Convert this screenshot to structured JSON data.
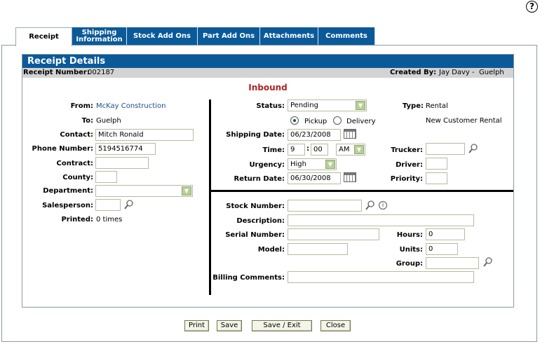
{
  "tabs": [
    {
      "label": "Receipt"
    },
    {
      "label": "Shipping Information"
    },
    {
      "label": "Stock Add Ons"
    },
    {
      "label": "Part Add Ons"
    },
    {
      "label": "Attachments"
    },
    {
      "label": "Comments"
    }
  ],
  "header": {
    "title": "Receipt Details",
    "receipt_number_label": "Receipt Number:",
    "receipt_number": "002187",
    "created_by_label": "Created By:",
    "created_by": "Jay Davy -  Guelph"
  },
  "section_title": "Inbound",
  "left": {
    "from_label": "From:",
    "from_value": "McKay Construction",
    "to_label": "To:",
    "to_value": "Guelph",
    "contact_label": "Contact:",
    "contact_value": "Mitch Ronald",
    "phone_label": "Phone Number:",
    "phone_value": "5194516774",
    "contract_label": "Contract:",
    "contract_value": "",
    "county_label": "County:",
    "county_value": "",
    "department_label": "Department:",
    "department_value": "",
    "salesperson_label": "Salesperson:",
    "salesperson_value": "",
    "printed_label": "Printed:",
    "printed_value": "0 times"
  },
  "right_top": {
    "status_label": "Status:",
    "status_value": "Pending",
    "type_label": "Type:",
    "type_value": "Rental",
    "pickup_label": "Pickup",
    "delivery_label": "Delivery",
    "new_customer_note": "New Customer Rental",
    "shipping_date_label": "Shipping Date:",
    "shipping_date_value": "06/23/2008",
    "time_label": "Time:",
    "time_hour": "9",
    "time_minute": "00",
    "time_ampm": "AM",
    "trucker_label": "Trucker:",
    "trucker_value": "",
    "urgency_label": "Urgency:",
    "urgency_value": "High",
    "driver_label": "Driver:",
    "driver_value": "",
    "return_date_label": "Return Date:",
    "return_date_value": "06/30/2008",
    "priority_label": "Priority:",
    "priority_value": ""
  },
  "right_bottom": {
    "stock_number_label": "Stock Number:",
    "stock_number_value": "",
    "description_label": "Description:",
    "description_value": "",
    "serial_number_label": "Serial Number:",
    "serial_number_value": "",
    "hours_label": "Hours:",
    "hours_value": "0",
    "model_label": "Model:",
    "model_value": "",
    "units_label": "Units:",
    "units_value": "0",
    "group_label": "Group:",
    "group_value": "",
    "billing_comments_label": "Billing Comments:",
    "billing_comments_value": ""
  },
  "buttons": {
    "print": "Print",
    "save": "Save",
    "save_exit": "Save / Exit",
    "close": "Close"
  },
  "icons": {
    "help": "?",
    "info": "i"
  },
  "colors": {
    "tab_blue": "#0a5a99",
    "section_red": "#b22222",
    "link_blue": "#1a4d8f"
  }
}
